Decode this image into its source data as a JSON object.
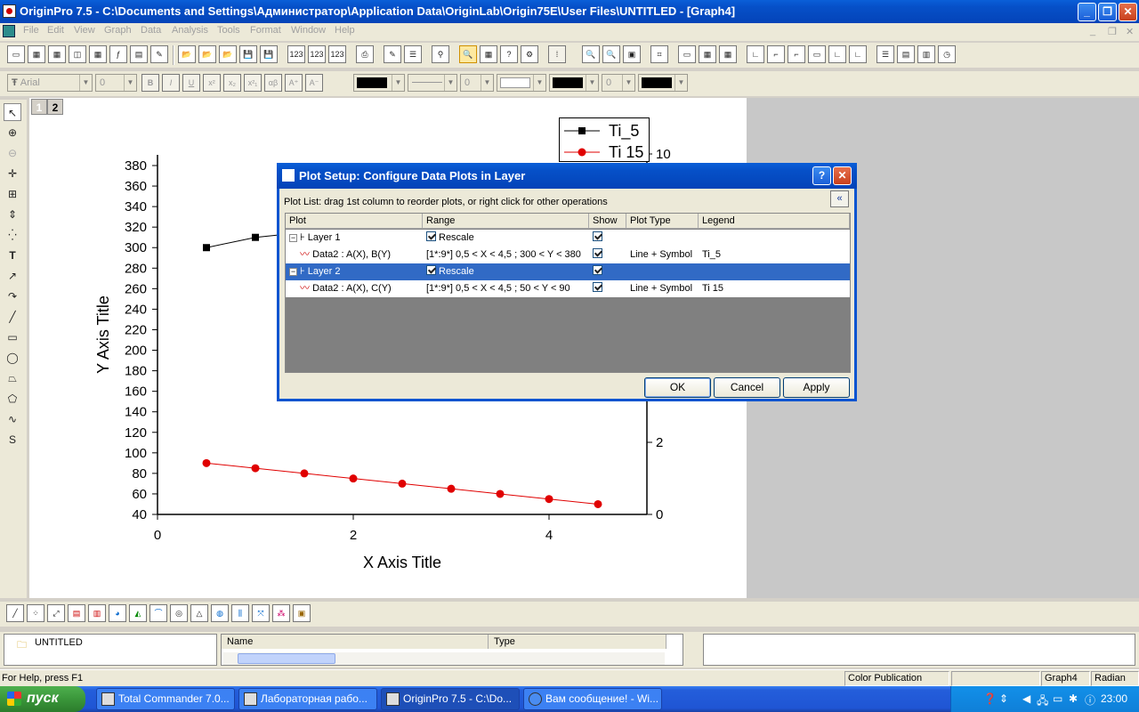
{
  "window": {
    "title": "OriginPro 7.5 - C:\\Documents and Settings\\Администратор\\Application Data\\OriginLab\\Origin75E\\User Files\\UNTITLED - [Graph4]",
    "minimize": "_",
    "maximize": "❐",
    "close": "✕"
  },
  "menu": [
    "File",
    "Edit",
    "View",
    "Graph",
    "Data",
    "Analysis",
    "Tools",
    "Format",
    "Window",
    "Help"
  ],
  "format_toolbar": {
    "font": "Arial",
    "size": "0",
    "bold": "B",
    "italic": "I",
    "underline": "U",
    "superscript": "x²",
    "subscript": "x₂",
    "supsub": "x²₁",
    "greek": "αβ",
    "grow": "A⁺",
    "shrink": "A⁻",
    "line_width": "0",
    "pattern_width": "0"
  },
  "graph": {
    "layer_tabs": [
      "1",
      "2"
    ],
    "x_title": "X Axis Title",
    "y_title": "Y Axis Title",
    "y_ticks": [
      "380",
      "360",
      "340",
      "320",
      "300",
      "280",
      "260",
      "240",
      "220",
      "200",
      "180",
      "160",
      "140",
      "120",
      "100",
      "80",
      "60",
      "40"
    ],
    "x_ticks": [
      "0",
      "2",
      "4"
    ],
    "y2_ticks": [
      "10",
      "2",
      "0"
    ],
    "legend": [
      {
        "label": "Ti_5",
        "color": "#000000",
        "symbol": "square"
      },
      {
        "label": "Ti 15",
        "color": "#e00000",
        "symbol": "circle"
      }
    ]
  },
  "chart_data": {
    "type": "line",
    "xlabel": "X Axis Title",
    "ylabel": "Y Axis Title",
    "xlim": [
      0,
      5
    ],
    "ylim": [
      40,
      390
    ],
    "series": [
      {
        "name": "Ti_5",
        "color": "#000000",
        "x": [
          0.5,
          1.0,
          1.5
        ],
        "y": [
          300,
          310,
          315
        ]
      },
      {
        "name": "Ti 15",
        "color": "#e00000",
        "x": [
          0.5,
          1.0,
          1.5,
          2.0,
          2.5,
          3.0,
          3.5,
          4.0,
          4.5
        ],
        "y": [
          90,
          85,
          80,
          75,
          70,
          65,
          60,
          55,
          50
        ]
      }
    ]
  },
  "dialog": {
    "title": "Plot Setup: Configure Data Plots in Layer",
    "help": "?",
    "close": "✕",
    "hint": "Plot List: drag 1st column to reorder plots, or right click for other operations",
    "collapse": "«",
    "columns": [
      "Plot",
      "Range",
      "Show",
      "Plot Type",
      "Legend"
    ],
    "rows": [
      {
        "plot": "Layer 1",
        "range": "Rescale",
        "type": "",
        "legend": ""
      },
      {
        "plot": "Data2 : A(X), B(Y)",
        "range": "[1*:9*]  0,5 < X < 4,5 ; 300 < Y < 380",
        "type": "Line + Symbol",
        "legend": "Ti_5"
      },
      {
        "plot": "Layer 2",
        "range": "Rescale",
        "type": "",
        "legend": ""
      },
      {
        "plot": "Data2 : A(X), C(Y)",
        "range": "[1*:9*]  0,5 < X < 4,5 ; 50 < Y < 90",
        "type": "Line + Symbol",
        "legend": "Ti 15"
      }
    ],
    "ok": "OK",
    "cancel": "Cancel",
    "apply": "Apply"
  },
  "project": {
    "folder": "UNTITLED",
    "col_name": "Name",
    "col_type": "Type"
  },
  "status": {
    "help": "For Help, press F1",
    "mode": "Color Publication",
    "window": "Graph4",
    "angle": "Radian"
  },
  "taskbar": {
    "start": "пуск",
    "tasks": [
      "Total Commander 7.0...",
      "Лабораторная рабо...",
      "OriginPro 7.5 - C:\\Do...",
      "Вам сообщение! - Wi..."
    ],
    "lang": "RU",
    "clock": "23:00"
  }
}
